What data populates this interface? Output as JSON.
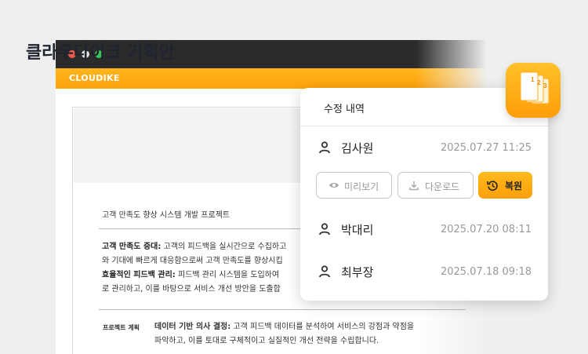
{
  "browser": {
    "brand": "CLOUDIKE"
  },
  "document": {
    "title": "클라우다이크 기획안",
    "subtitle": "고객 만족도 향상 시스템 개발 프로젝트",
    "paragraph1": {
      "line1_bold": "고객 만족도 증대:",
      "line1_text": " 고객의 피드백을 실시간으로 수집하고",
      "line2_text": "와 기대에 빠르게 대응함으로써 고객 만족도를 향상시킵",
      "line3_bold": "효율적인 피드백 관리:",
      "line3_text": " 피드백 관리 시스템을 도입하여 ",
      "line4_text": "로 관리하고, 이를 바탕으로 서비스 개선 방안을 도출합"
    },
    "section_label": "프로젝트 계획",
    "paragraph2": {
      "line1_bold": "데이터 기반 의사 결정:",
      "line1_text": " 고객 피드백 데이터를 분석하여 서비스의 강점과 약점을",
      "line2_text": "파악하고, 이를 토대로 구체적이고 실질적인 개선 전략을 수립합니다."
    },
    "colors": {
      "brand_orange": "#ffa20d",
      "titlebar": "#2b2b2b"
    }
  },
  "revision_panel": {
    "title": "수정 내역",
    "entries": [
      {
        "name": "김사원",
        "timestamp": "2025.07.27 11:25"
      },
      {
        "name": "박대리",
        "timestamp": "2025.07.20 08:11"
      },
      {
        "name": "최부장",
        "timestamp": "2025.07.18 09:18"
      }
    ],
    "actions": {
      "preview": "미리보기",
      "download": "다운로드",
      "restore": "복원"
    },
    "icons": [
      "user-icon",
      "eye-icon",
      "download-icon",
      "restore-icon"
    ]
  },
  "app_icon": {
    "name": "version-docs-icon",
    "labels": [
      "1",
      "2",
      "3"
    ]
  }
}
